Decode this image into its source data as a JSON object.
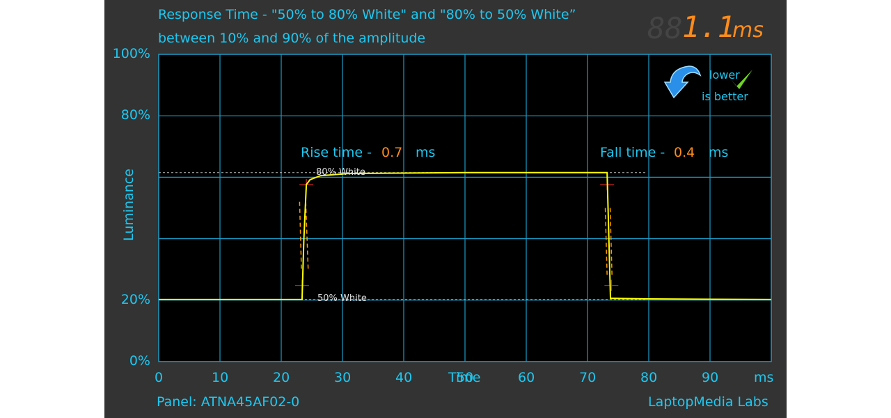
{
  "chart_data": {
    "type": "line",
    "title": "Response Time - \"50% to 80% White\" and \"80% to 50% White”",
    "subtitle": "between 10% and 90% of the amplitude",
    "xlabel": "Time",
    "xunit": "ms",
    "ylabel": "Luminance",
    "xlim": [
      0,
      100
    ],
    "ylim": [
      0,
      100
    ],
    "x_ticks": [
      "0",
      "10",
      "20",
      "30",
      "40",
      "50",
      "60",
      "70",
      "80",
      "90"
    ],
    "y_ticks": [
      {
        "v": 0,
        "label": "0%"
      },
      {
        "v": 20,
        "label": "20%"
      },
      {
        "v": 80,
        "label": "80%"
      },
      {
        "v": 100,
        "label": "100%"
      }
    ],
    "grid": true,
    "series": [
      {
        "color": "#ffff00",
        "x": [
          0,
          23.4,
          23.7,
          24.1,
          24.7,
          26.4,
          30.9,
          50,
          73.2,
          73.75,
          79.8,
          100
        ],
        "y": [
          20.2,
          20.2,
          40,
          57.6,
          59.2,
          60.5,
          61.2,
          61.5,
          61.5,
          20.6,
          20.4,
          20.2
        ]
      }
    ],
    "reference_lines": [
      {
        "y": 61.5,
        "label": "80% White"
      },
      {
        "y": 20.2,
        "label": "50% White"
      }
    ],
    "annotations": {
      "rise_label": "Rise time - ",
      "rise_value": "0.7",
      "fall_label": "Fall time - ",
      "fall_value": "0.4",
      "unit": "ms"
    },
    "total": {
      "value": "1.1",
      "unit": "ms"
    },
    "badge": {
      "line1": "lower",
      "line2": "is better"
    },
    "panel": "Panel: ATNA45AF02-0",
    "brand": "LaptopMedia Labs",
    "colors": {
      "text": "#1ec8f0",
      "grid": "#1a9cc8",
      "value": "#ff8c1a",
      "curve": "#ffff00",
      "marker": "#cc2222"
    }
  }
}
